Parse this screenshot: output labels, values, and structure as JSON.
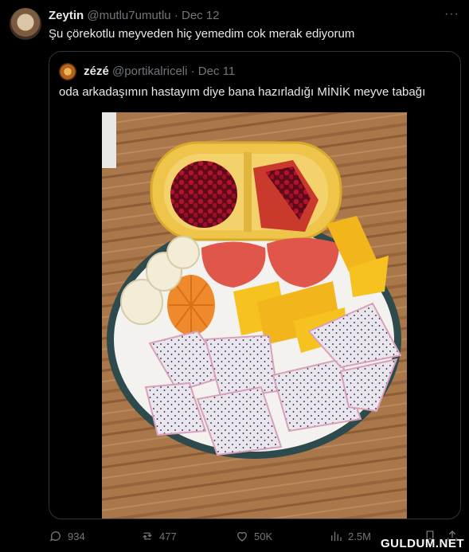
{
  "tweet": {
    "author_name": "Zeytin",
    "author_handle": "@mutlu7umutlu",
    "date": "Dec 12",
    "text": "Şu çörekotlu meyveden hiç yemedim cok merak ediyorum",
    "more": "···"
  },
  "quoted": {
    "author_name": "zézé",
    "author_handle": "@portikalriceli",
    "date": "Dec 11",
    "text": "oda arkadaşımın hastayım diye bana hazırladığı MİNİK meyve tabağı"
  },
  "actions": {
    "replies": "934",
    "retweets": "477",
    "likes": "50K",
    "views": "2.5M"
  },
  "watermark": "GULDUM.NET"
}
